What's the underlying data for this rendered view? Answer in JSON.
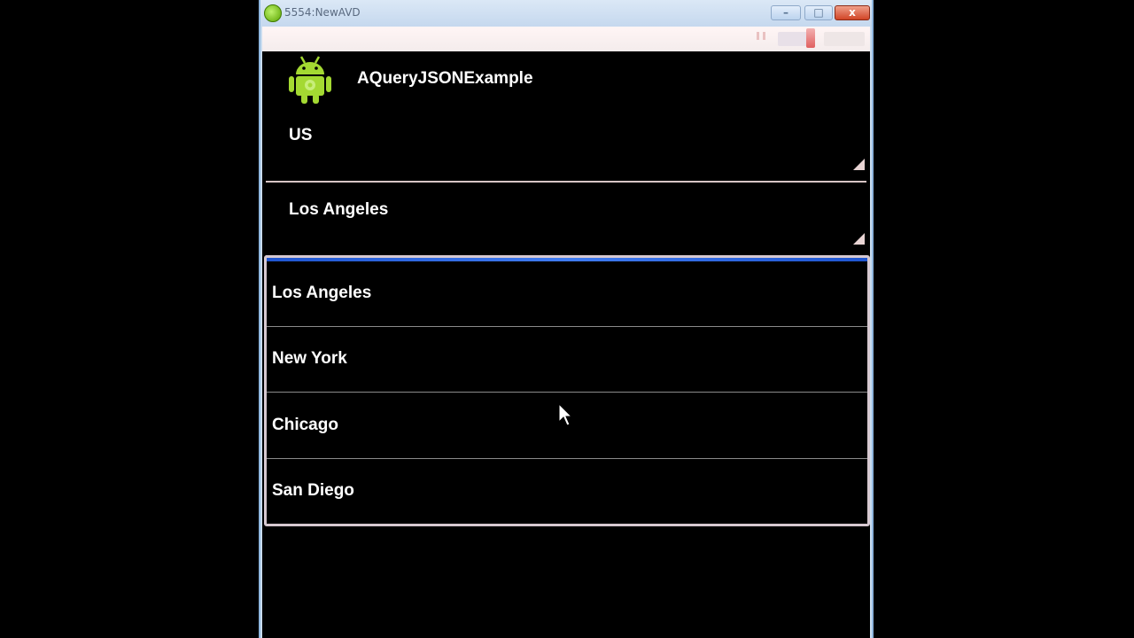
{
  "window": {
    "title": "5554:NewAVD",
    "min_label": "–",
    "max_label": "□",
    "close_label": "x"
  },
  "app": {
    "title": "AQueryJSONExample",
    "icon": "android-icon"
  },
  "spinners": {
    "country": "US",
    "city": "Los Angeles"
  },
  "dropdown": {
    "items": [
      "Los Angeles",
      "New York",
      "Chicago",
      "San Diego"
    ]
  },
  "colors": {
    "accent": "#2f6ae8",
    "android_green": "#a4d932"
  }
}
